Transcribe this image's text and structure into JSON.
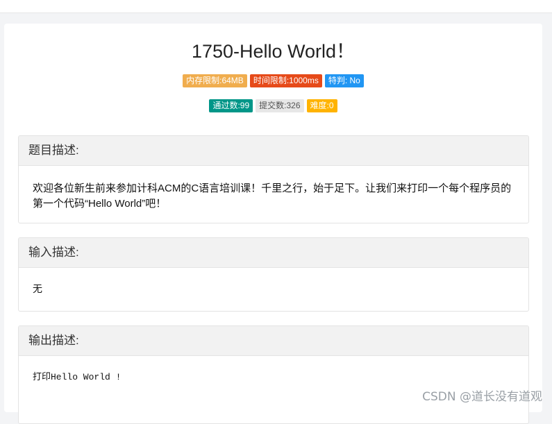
{
  "problem": {
    "title": "1750-Hello World！"
  },
  "badges_row1": [
    {
      "label": "内存限制:64MB",
      "color": "#f0ad4e"
    },
    {
      "label": "时间限制:1000ms",
      "color": "#e64a19"
    },
    {
      "label": "特判: No",
      "color": "#2196f3"
    }
  ],
  "badges_row2": [
    {
      "label": "通过数:99",
      "color": "#009688"
    },
    {
      "label": "提交数:326",
      "color": "#e7e7e7"
    },
    {
      "label": "难度:0",
      "color": "#ffb300"
    }
  ],
  "sections": {
    "description": {
      "heading": "题目描述:",
      "body": "欢迎各位新生前来参加计科ACM的C语言培训课！千里之行，始于足下。让我们来打印一个每个程序员的第一个代码“Hello World”吧！"
    },
    "input": {
      "heading": "输入描述:",
      "body": "无"
    },
    "output": {
      "heading": "输出描述:",
      "body": "打印Hello World !"
    }
  },
  "watermark": "CSDN @道长没有道观"
}
